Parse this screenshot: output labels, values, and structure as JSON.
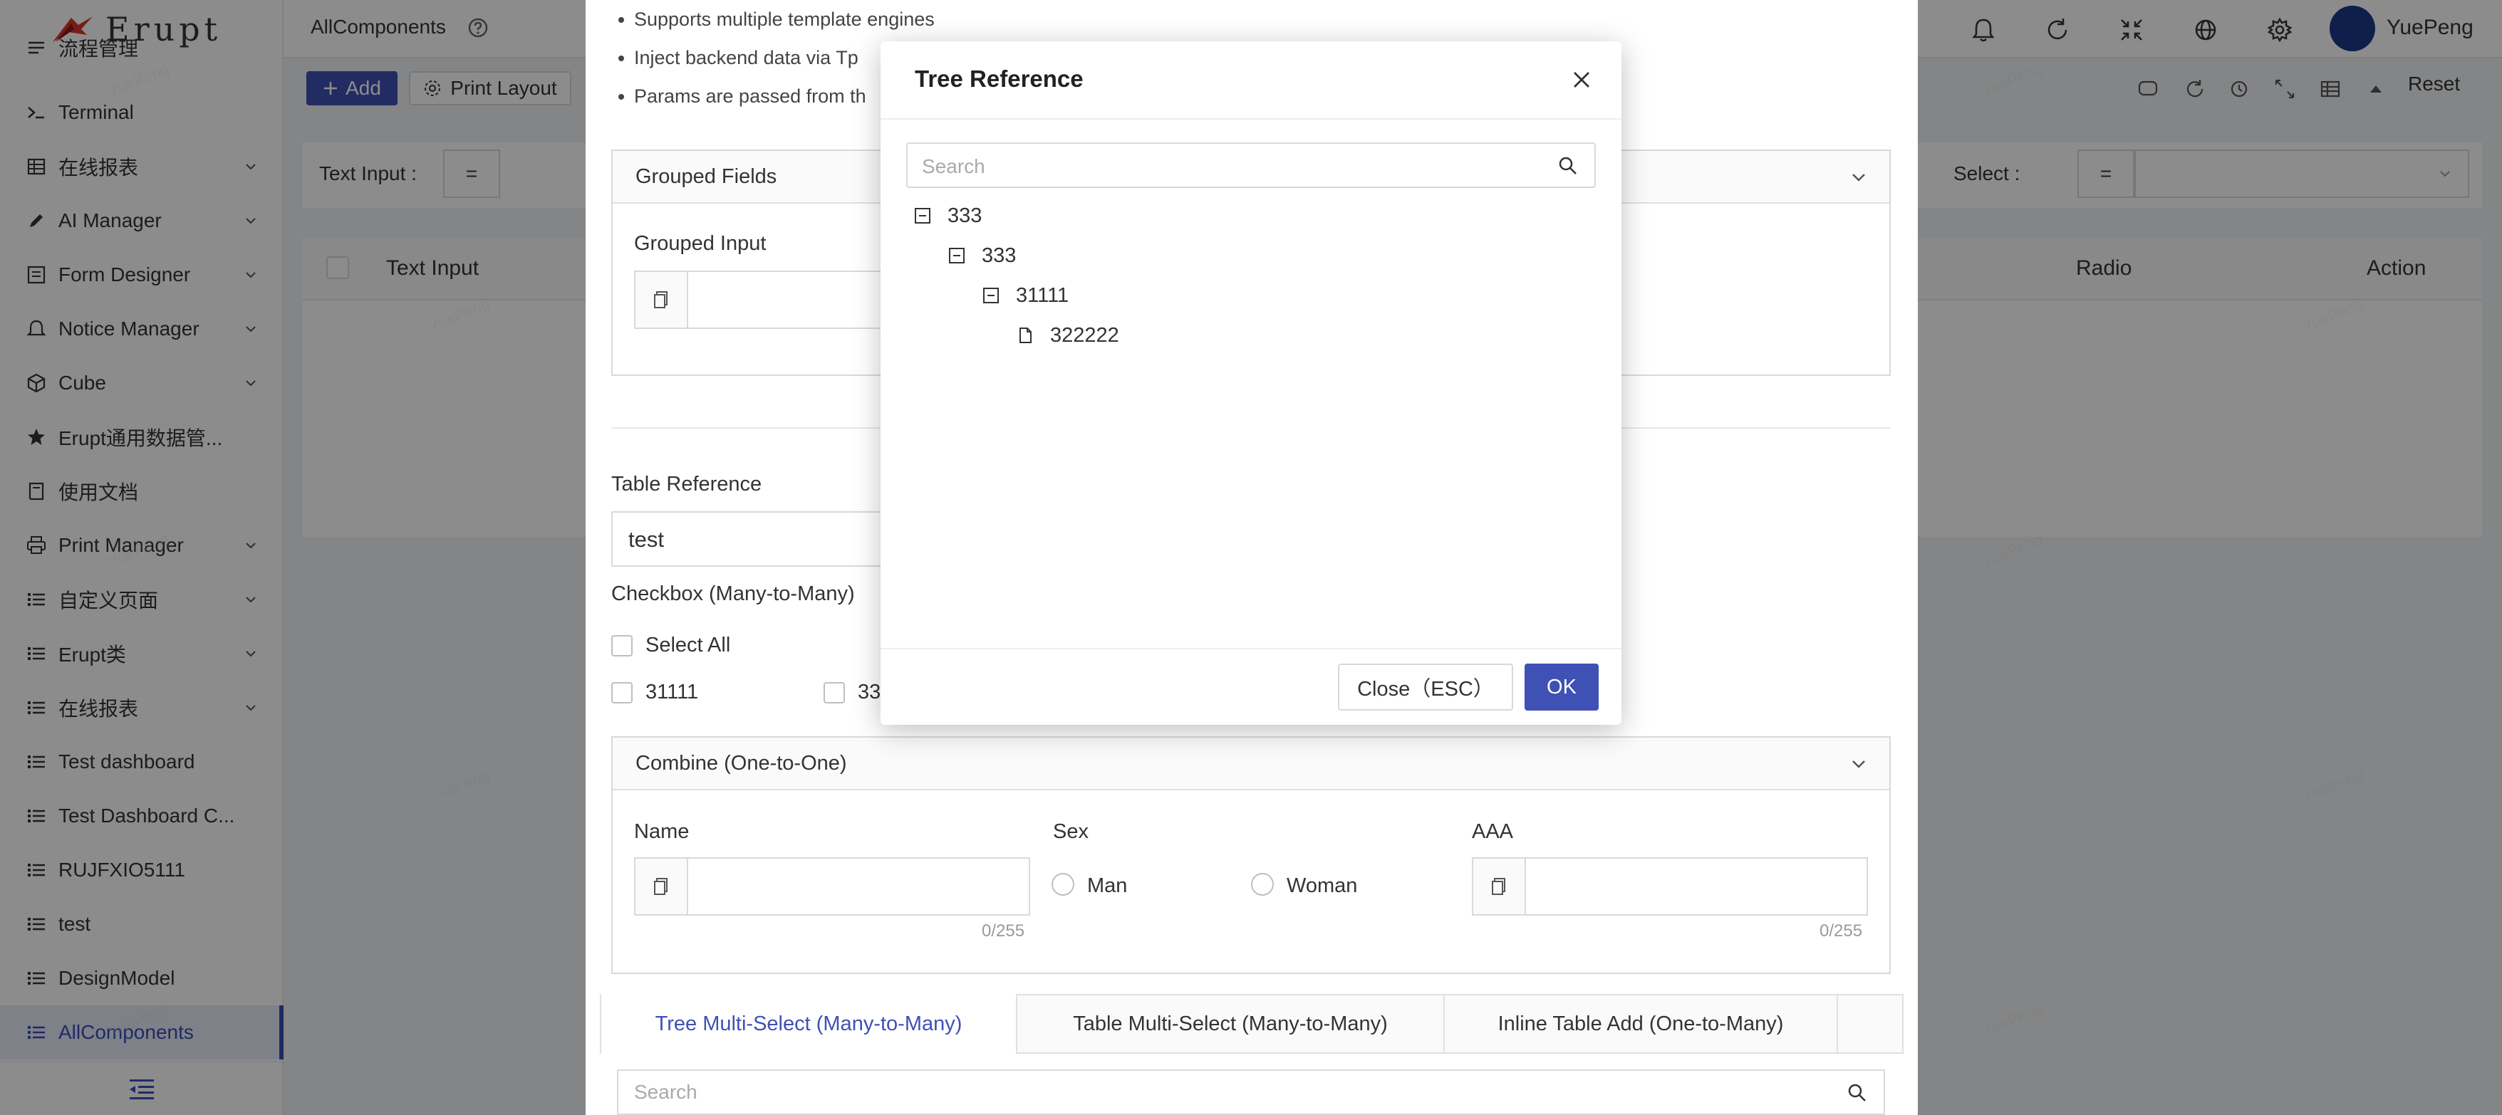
{
  "app": {
    "logo_text": "Erupt",
    "tab_title": "AllComponents",
    "user_name": "YuePeng"
  },
  "sidebar": {
    "items": [
      {
        "label": "流程管理",
        "icon": "workflow-icon",
        "has_children": false
      },
      {
        "label": "Terminal",
        "icon": "terminal-icon",
        "has_children": false
      },
      {
        "label": "在线报表",
        "icon": "table-icon",
        "has_children": true
      },
      {
        "label": "AI Manager",
        "icon": "ai-pen-icon",
        "has_children": true
      },
      {
        "label": "Form Designer",
        "icon": "form-icon",
        "has_children": true
      },
      {
        "label": "Notice Manager",
        "icon": "bell-icon",
        "has_children": true
      },
      {
        "label": "Cube",
        "icon": "cube-icon",
        "has_children": true
      },
      {
        "label": "Erupt通用数据管...",
        "icon": "star-icon",
        "has_children": false
      },
      {
        "label": "使用文档",
        "icon": "book-icon",
        "has_children": false
      },
      {
        "label": "Print Manager",
        "icon": "printer-icon",
        "has_children": true
      },
      {
        "label": "自定义页面",
        "icon": "list-icon",
        "has_children": true
      },
      {
        "label": "Erupt类",
        "icon": "list-icon",
        "has_children": true
      },
      {
        "label": "在线报表",
        "icon": "list-icon",
        "has_children": true
      },
      {
        "label": "Test dashboard",
        "icon": "list-icon",
        "has_children": false
      },
      {
        "label": "Test Dashboard C...",
        "icon": "list-icon",
        "has_children": false
      },
      {
        "label": "RUJFXIO5111",
        "icon": "list-icon",
        "has_children": false
      },
      {
        "label": "test",
        "icon": "list-icon",
        "has_children": false
      },
      {
        "label": "DesignModel",
        "icon": "list-icon",
        "has_children": false
      },
      {
        "label": "AllComponents",
        "icon": "list-icon",
        "has_children": false,
        "active": true
      }
    ]
  },
  "toolbar": {
    "add_label": "Add",
    "print_label": "Print Layout",
    "reset_label": "Reset"
  },
  "filters": {
    "text_input_label": "Text Input :",
    "operator1": "=",
    "select_label": "Select :",
    "operator2": "="
  },
  "table": {
    "headers": {
      "text_input": "Text Input",
      "radio": "Radio",
      "action": "Action"
    }
  },
  "form": {
    "bullets": [
      "Supports multiple template engines",
      "Inject backend data via Tp",
      "Params are passed from th"
    ],
    "grouped_fields": {
      "title": "Grouped Fields",
      "grouped_input_label": "Grouped Input"
    },
    "table_reference": {
      "label": "Table Reference",
      "value": "test"
    },
    "checkbox_m2m": {
      "label": "Checkbox (Many-to-Many)",
      "select_all": "Select All",
      "options": [
        "31111",
        "33"
      ]
    },
    "combine": {
      "title": "Combine (One-to-One)",
      "name_label": "Name",
      "name_counter": "0/255",
      "sex_label": "Sex",
      "sex_options": [
        "Man",
        "Woman"
      ],
      "aaa_label": "AAA",
      "aaa_counter": "0/255"
    },
    "bottom_tabs": [
      "Tree Multi-Select (Many-to-Many)",
      "Table Multi-Select (Many-to-Many)",
      "Inline Table Add (One-to-Many)"
    ],
    "bottom_search_placeholder": "Search"
  },
  "modal": {
    "title": "Tree Reference",
    "search_placeholder": "Search",
    "tree": [
      {
        "label": "333",
        "level": 0,
        "type": "expanded"
      },
      {
        "label": "333",
        "level": 1,
        "type": "expanded"
      },
      {
        "label": "31111",
        "level": 2,
        "type": "expanded"
      },
      {
        "label": "322222",
        "level": 3,
        "type": "leaf"
      }
    ],
    "close_label": "Close（ESC）",
    "ok_label": "OK"
  },
  "colors": {
    "primary": "#3f51b5",
    "overlay": "rgba(0,0,0,0.45)",
    "active_bg": "#e6ebf7"
  }
}
